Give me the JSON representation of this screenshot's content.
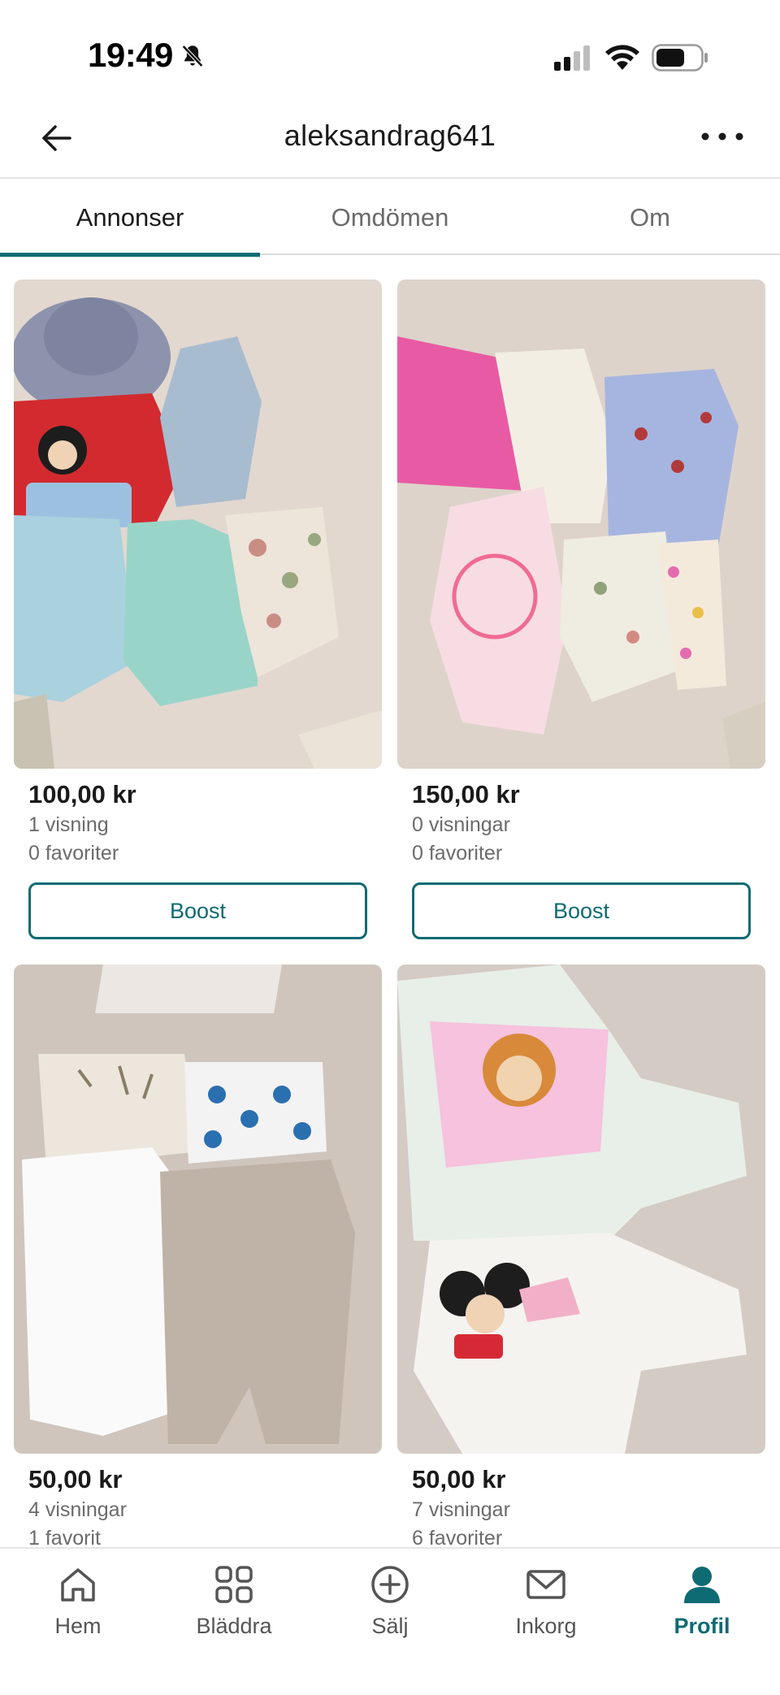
{
  "status_bar": {
    "time": "19:49",
    "icons": [
      "bell-slash-icon",
      "cell-signal-icon",
      "wifi-icon",
      "battery-icon"
    ]
  },
  "header": {
    "title": "aleksandrag641",
    "back_icon": "arrow-left-icon",
    "more_icon": "more-horizontal-icon"
  },
  "tabs": [
    {
      "label": "Annonser",
      "active": true
    },
    {
      "label": "Omdömen",
      "active": false
    },
    {
      "label": "Om",
      "active": false
    }
  ],
  "listings": [
    {
      "price": "100,00 kr",
      "views": "1 visning",
      "favorites": "0 favoriter",
      "button": "Boost"
    },
    {
      "price": "150,00 kr",
      "views": "0 visningar",
      "favorites": "0 favoriter",
      "button": "Boost"
    },
    {
      "price": "50,00 kr",
      "views": "4 visningar",
      "favorites": "1 favorit"
    },
    {
      "price": "50,00 kr",
      "views": "7 visningar",
      "favorites": "6 favoriter"
    }
  ],
  "bottom_nav": [
    {
      "label": "Hem",
      "icon": "home-icon",
      "active": false
    },
    {
      "label": "Bläddra",
      "icon": "grid-icon",
      "active": false
    },
    {
      "label": "Sälj",
      "icon": "plus-circle-icon",
      "active": false
    },
    {
      "label": "Inkorg",
      "icon": "mail-icon",
      "active": false
    },
    {
      "label": "Profil",
      "icon": "person-icon",
      "active": true
    }
  ],
  "colors": {
    "accent": "#0e6b74",
    "text": "#1a1a1a",
    "muted": "#6b6b6b",
    "divider": "#e4e4e4"
  }
}
